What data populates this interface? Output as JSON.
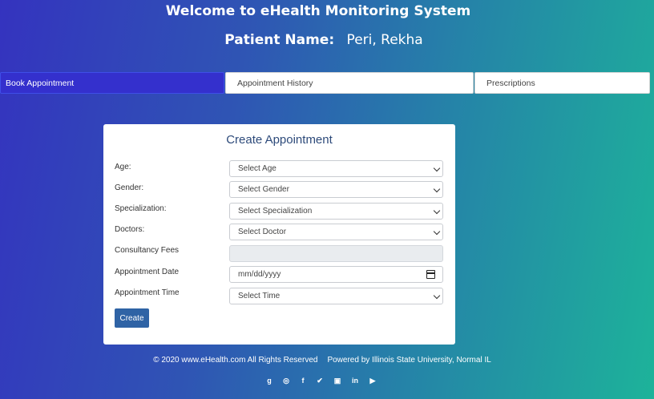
{
  "header": {
    "welcome": "Welcome to eHealth Monitoring System",
    "patient_label": "Patient Name:",
    "patient_name": "Peri, Rekha"
  },
  "tabs": [
    {
      "label": "Book Appointment",
      "active": true
    },
    {
      "label": "Appointment History",
      "active": false
    },
    {
      "label": "Prescriptions",
      "active": false
    }
  ],
  "form": {
    "title": "Create Appointment",
    "age": {
      "label": "Age:",
      "value": "Select Age"
    },
    "gender": {
      "label": "Gender:",
      "value": "Select Gender"
    },
    "specialization": {
      "label": "Specialization:",
      "value": "Select Specialization"
    },
    "doctors": {
      "label": "Doctors:",
      "value": "Select Doctor"
    },
    "fees": {
      "label": "Consultancy Fees",
      "value": ""
    },
    "date": {
      "label": "Appointment Date",
      "placeholder": "mm/dd/yyyy"
    },
    "time": {
      "label": "Appointment Time",
      "value": "Select Time"
    },
    "submit_label": "Create"
  },
  "footer": {
    "copyright": "© 2020 www.eHealth.com All Rights Reserved",
    "powered": "Powered by Illinois State University, Normal IL"
  },
  "social": [
    {
      "icon": "google-plus-icon",
      "glyph": "g"
    },
    {
      "icon": "whatsapp-icon",
      "glyph": "◎"
    },
    {
      "icon": "facebook-icon",
      "glyph": "f"
    },
    {
      "icon": "twitter-icon",
      "glyph": "✔"
    },
    {
      "icon": "instagram-icon",
      "glyph": "▣"
    },
    {
      "icon": "linkedin-icon",
      "glyph": "in"
    },
    {
      "icon": "youtube-icon",
      "glyph": "▶"
    }
  ]
}
